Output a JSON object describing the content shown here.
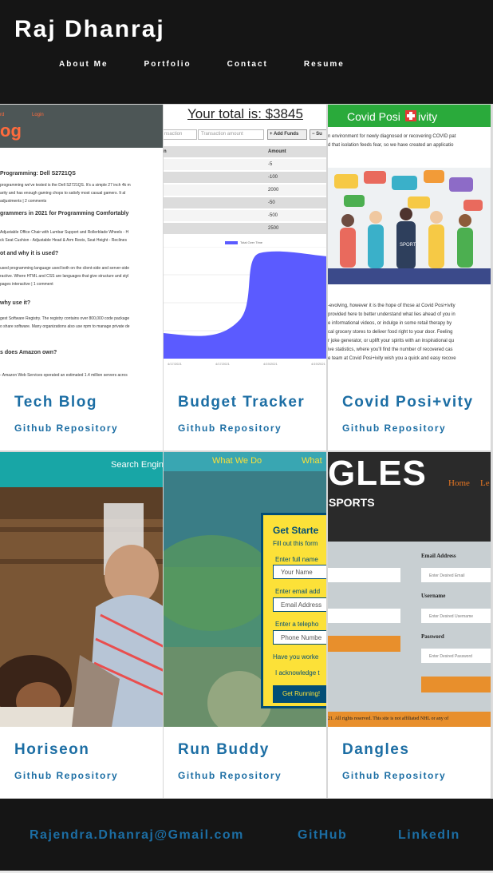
{
  "header": {
    "title": "Raj Dhanraj",
    "nav": [
      "About Me",
      "Portfolio",
      "Contact",
      "Resume"
    ]
  },
  "projects": [
    {
      "title": "Tech Blog",
      "link": "Github Repository",
      "thumb": {
        "nav": [
          "rd",
          "Login"
        ],
        "logo": "og",
        "lines": [
          "Programming: Dell S2721QS",
          "programming we've tested is the Dell S2721QS. It's a simple 27 inch 4k m",
          "arity and has enough gaming chops to satisfy most casual gamers. It al",
          "adjustments | 2 comments",
          "grammers in 2021 for Programming Comfortably",
          "Adjustable Office Chair with Lumbar Support and Rollerblade Wheels - H",
          "ck Seat Cushion - Adjustable Head & Arm Rests, Seat Height - Reclines",
          "ot and why it is used?",
          "used programming language used both on the client-side and server-side",
          "ractive. Where HTML and CSS are languages that give structure and styl",
          "pages interactive | 1 comment",
          "why use it?",
          "gest Software Registry. The registry contains over 800,000 code package",
          "o share software. Many organizations also use npm to manage private de",
          "s does Amazon own?",
          "- Amazon Web Services operated an estimated 1.4 million servers acros"
        ]
      }
    },
    {
      "title": "Budget Tracker",
      "link": "Github Repository",
      "thumb": {
        "total": "Your total is: $3845",
        "ph_name": "nsaction",
        "ph_amount": "Transaction amount",
        "btn_add": "+ Add Funds",
        "btn_sub": "− Su",
        "col_name": "n",
        "col_amount": "Amount",
        "amounts": [
          "-5",
          "-100",
          "2000",
          "-50",
          "-500",
          "2500"
        ],
        "legend": "Total Over Time",
        "dates": [
          "4/17/2021",
          "4/17/2021",
          "4/19/2021",
          "4/19/2021"
        ]
      }
    },
    {
      "title": "Covid Posi+vity",
      "link": "Github Repository",
      "thumb": {
        "brand_a": "Covid Posi",
        "brand_b": "ivity",
        "intro": [
          "n environment for newly diagnosed or recovering COVID pat",
          "d that isolation feeds fear, so we have created an applicatio"
        ],
        "body": [
          "-evolving, however it is the hope of those at Covid Posi+ivity",
          "provided here to better understand what lies ahead of you in",
          "e informational videos, or indulge in some retail therapy by",
          "cal grocery stores to deliver food right to your door. Feeling",
          "r joke generator, or uplift your spirits with an inspirational qu",
          "ive statistics, where you'll find the number of recovered cas",
          "e team at Covid Posi+ivity wish you a quick and easy recove"
        ],
        "sport": "SPORT"
      }
    },
    {
      "title": "Horiseon",
      "link": "Github Repository",
      "thumb": {
        "nav": "Search Engine"
      }
    },
    {
      "title": "Run Buddy",
      "link": "Github Repository",
      "thumb": {
        "nav": [
          "What We Do",
          "What"
        ],
        "heading": "Get Starte",
        "sub": "Fill out this form",
        "label_name": "Enter full name",
        "ph_name": "Your Name",
        "label_email": "Enter email add",
        "ph_email": "Email Address",
        "label_phone": "Enter a telepho",
        "ph_phone": "Phone Numbe",
        "q": "Have you worke",
        "ack": "I acknowledge t",
        "btn": "Get Running!"
      }
    },
    {
      "title": "Dangles",
      "link": "Github Repository",
      "thumb": {
        "logo": "GLES",
        "sub": "SPORTS",
        "nav": [
          "Home",
          "Le"
        ],
        "email_label": "Email Address",
        "email_ph": "Enter Desired Email",
        "user_label": "Username",
        "user_ph": "Enter Desired Username",
        "pass_label": "Password",
        "pass_ph": "Enter Desired Password",
        "footer": "21. All rights reserved. This site is not affiliated NHL or any of"
      }
    }
  ],
  "footer": {
    "email": "Rajendra.Dhanraj@Gmail.com",
    "github": "GitHub",
    "linkedin": "LinkedIn"
  },
  "colors": {
    "accent": "#1c6ea4",
    "header_bg": "#151515",
    "runbuddy_yellow": "#fce138",
    "covid_green": "#2aaa3b"
  }
}
